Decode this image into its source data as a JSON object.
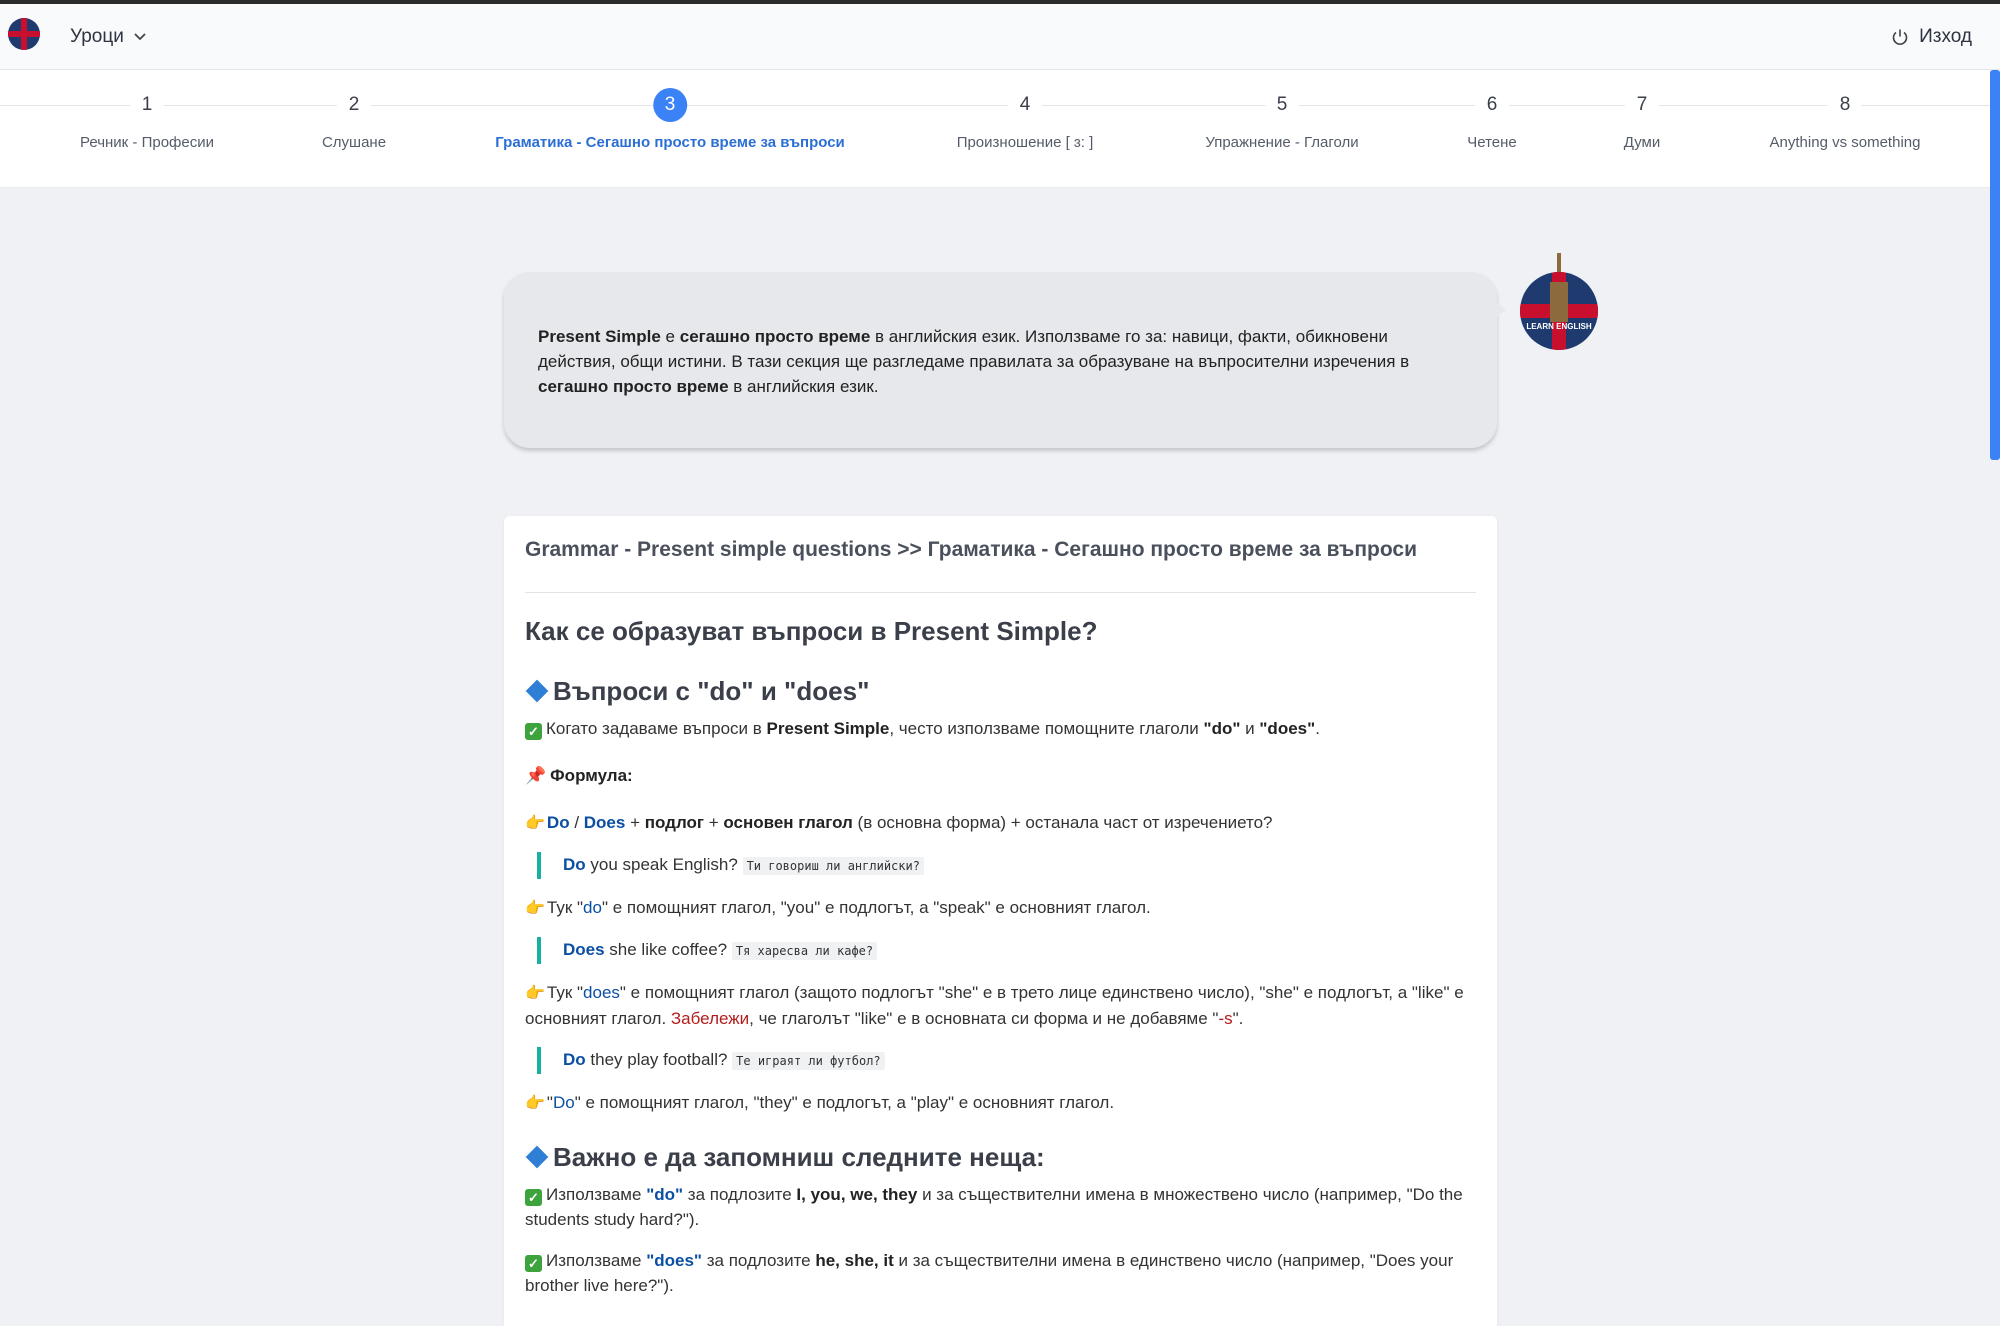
{
  "navbar": {
    "menu_label": "Уроци",
    "logout_label": "Изход"
  },
  "steps": [
    {
      "num": "1",
      "label": "Речник - Професии"
    },
    {
      "num": "2",
      "label": "Слушане"
    },
    {
      "num": "3",
      "label": "Граматика - Сегашно просто време за въпроси"
    },
    {
      "num": "4",
      "label": "Произношение [ ɜ: ]"
    },
    {
      "num": "5",
      "label": "Упражнение - Глаголи"
    },
    {
      "num": "6",
      "label": "Четене"
    },
    {
      "num": "7",
      "label": "Думи"
    },
    {
      "num": "8",
      "label": "Anything vs something"
    }
  ],
  "active_step": 3,
  "intro": {
    "t1": "Present Simple",
    "t2": " е ",
    "t3": "сегашно просто време",
    "t4": " в английския език. Използваме го за: навици, факти, обикновени действия, общи истини. В тази секция ще разгледаме правилата за образуване на въпросителни изречения в ",
    "t5": "сегашно просто време",
    "t6": " в английския език."
  },
  "logo_text": "LEARN ENGLISH",
  "card": {
    "title": "Grammar - Present simple questions >> Граматика - Сегашно просто време за въпроси",
    "h1": "Как се образуват въпроси в Present Simple?",
    "h2_a": "Въпроси с \"do\" и \"does\"",
    "p1": {
      "a": "Когато задаваме въпроси в ",
      "b": "Present Simple",
      "c": ", често използваме помощните глаголи ",
      "d": "\"do\"",
      "e": " и ",
      "f": "\"does\"",
      "g": "."
    },
    "formula_label": "Формула:",
    "formula": {
      "do": "Do",
      "slash": " / ",
      "does": "Does",
      "plus1": " + ",
      "subject": "подлог",
      "plus2": " + ",
      "verb": "основен глагол",
      "rest": " (в основна форма) + останала част от изречението?"
    },
    "ex1": {
      "aux": "Do",
      "text": " you speak English? ",
      "tr": "Ти говориш ли английски?"
    },
    "note1": {
      "a": "Тук \"",
      "b": "do",
      "c": "\" е помощният глагол, \"you\" е подлогът, а \"speak\" е основният глагол."
    },
    "ex2": {
      "aux": "Does",
      "text": " she like coffee? ",
      "tr": "Тя харесва ли кафе?"
    },
    "note2": {
      "a": "Тук \"",
      "b": "does",
      "c": "\" е помощният глагол (защото подлогът \"she\" е в трето лице единствено число), \"she\" е подлогът, а \"like\" е основният глагол. ",
      "d": "Забележи",
      "e": ", че глаголът \"like\" е в основната си форма и не добавяме \"",
      "f": "-s",
      "g": "\"."
    },
    "ex3": {
      "aux": "Do",
      "text": " they play football? ",
      "tr": "Те играят ли футбол?"
    },
    "note3": {
      "a": "\"",
      "b": "Do",
      "c": "\" е помощният глагол, \"they\" е подлогът, а \"play\" е основният глагол."
    },
    "h2_b": "Важно е да запомниш следните неща:",
    "r1": {
      "a": "Използваме ",
      "b": "\"do\"",
      "c": " за подлозите ",
      "d": "I, you, we, they",
      "e": " и за съществителни имена в множествено число (например, \"Do the students study hard?\")."
    },
    "r2": {
      "a": "Използваме ",
      "b": "\"does\"",
      "c": " за подлозите ",
      "d": "he, she, it",
      "e": " и за съществителни имена в единствено число (например, \"Does your brother live here?\")."
    }
  }
}
